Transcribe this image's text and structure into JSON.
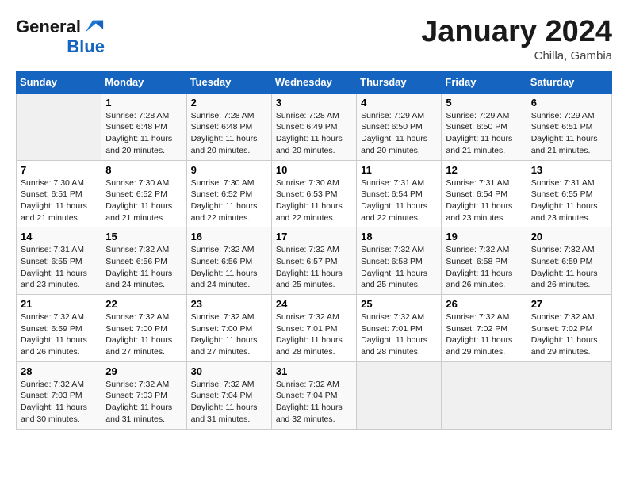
{
  "header": {
    "logo_line1": "General",
    "logo_line2": "Blue",
    "month_title": "January 2024",
    "location": "Chilla, Gambia"
  },
  "weekdays": [
    "Sunday",
    "Monday",
    "Tuesday",
    "Wednesday",
    "Thursday",
    "Friday",
    "Saturday"
  ],
  "weeks": [
    [
      {
        "day": "",
        "empty": true
      },
      {
        "day": "1",
        "sunrise": "7:28 AM",
        "sunset": "6:48 PM",
        "daylight": "11 hours and 20 minutes."
      },
      {
        "day": "2",
        "sunrise": "7:28 AM",
        "sunset": "6:48 PM",
        "daylight": "11 hours and 20 minutes."
      },
      {
        "day": "3",
        "sunrise": "7:28 AM",
        "sunset": "6:49 PM",
        "daylight": "11 hours and 20 minutes."
      },
      {
        "day": "4",
        "sunrise": "7:29 AM",
        "sunset": "6:50 PM",
        "daylight": "11 hours and 20 minutes."
      },
      {
        "day": "5",
        "sunrise": "7:29 AM",
        "sunset": "6:50 PM",
        "daylight": "11 hours and 21 minutes."
      },
      {
        "day": "6",
        "sunrise": "7:29 AM",
        "sunset": "6:51 PM",
        "daylight": "11 hours and 21 minutes."
      }
    ],
    [
      {
        "day": "7",
        "sunrise": "7:30 AM",
        "sunset": "6:51 PM",
        "daylight": "11 hours and 21 minutes."
      },
      {
        "day": "8",
        "sunrise": "7:30 AM",
        "sunset": "6:52 PM",
        "daylight": "11 hours and 21 minutes."
      },
      {
        "day": "9",
        "sunrise": "7:30 AM",
        "sunset": "6:52 PM",
        "daylight": "11 hours and 22 minutes."
      },
      {
        "day": "10",
        "sunrise": "7:30 AM",
        "sunset": "6:53 PM",
        "daylight": "11 hours and 22 minutes."
      },
      {
        "day": "11",
        "sunrise": "7:31 AM",
        "sunset": "6:54 PM",
        "daylight": "11 hours and 22 minutes."
      },
      {
        "day": "12",
        "sunrise": "7:31 AM",
        "sunset": "6:54 PM",
        "daylight": "11 hours and 23 minutes."
      },
      {
        "day": "13",
        "sunrise": "7:31 AM",
        "sunset": "6:55 PM",
        "daylight": "11 hours and 23 minutes."
      }
    ],
    [
      {
        "day": "14",
        "sunrise": "7:31 AM",
        "sunset": "6:55 PM",
        "daylight": "11 hours and 23 minutes."
      },
      {
        "day": "15",
        "sunrise": "7:32 AM",
        "sunset": "6:56 PM",
        "daylight": "11 hours and 24 minutes."
      },
      {
        "day": "16",
        "sunrise": "7:32 AM",
        "sunset": "6:56 PM",
        "daylight": "11 hours and 24 minutes."
      },
      {
        "day": "17",
        "sunrise": "7:32 AM",
        "sunset": "6:57 PM",
        "daylight": "11 hours and 25 minutes."
      },
      {
        "day": "18",
        "sunrise": "7:32 AM",
        "sunset": "6:58 PM",
        "daylight": "11 hours and 25 minutes."
      },
      {
        "day": "19",
        "sunrise": "7:32 AM",
        "sunset": "6:58 PM",
        "daylight": "11 hours and 26 minutes."
      },
      {
        "day": "20",
        "sunrise": "7:32 AM",
        "sunset": "6:59 PM",
        "daylight": "11 hours and 26 minutes."
      }
    ],
    [
      {
        "day": "21",
        "sunrise": "7:32 AM",
        "sunset": "6:59 PM",
        "daylight": "11 hours and 26 minutes."
      },
      {
        "day": "22",
        "sunrise": "7:32 AM",
        "sunset": "7:00 PM",
        "daylight": "11 hours and 27 minutes."
      },
      {
        "day": "23",
        "sunrise": "7:32 AM",
        "sunset": "7:00 PM",
        "daylight": "11 hours and 27 minutes."
      },
      {
        "day": "24",
        "sunrise": "7:32 AM",
        "sunset": "7:01 PM",
        "daylight": "11 hours and 28 minutes."
      },
      {
        "day": "25",
        "sunrise": "7:32 AM",
        "sunset": "7:01 PM",
        "daylight": "11 hours and 28 minutes."
      },
      {
        "day": "26",
        "sunrise": "7:32 AM",
        "sunset": "7:02 PM",
        "daylight": "11 hours and 29 minutes."
      },
      {
        "day": "27",
        "sunrise": "7:32 AM",
        "sunset": "7:02 PM",
        "daylight": "11 hours and 29 minutes."
      }
    ],
    [
      {
        "day": "28",
        "sunrise": "7:32 AM",
        "sunset": "7:03 PM",
        "daylight": "11 hours and 30 minutes."
      },
      {
        "day": "29",
        "sunrise": "7:32 AM",
        "sunset": "7:03 PM",
        "daylight": "11 hours and 31 minutes."
      },
      {
        "day": "30",
        "sunrise": "7:32 AM",
        "sunset": "7:04 PM",
        "daylight": "11 hours and 31 minutes."
      },
      {
        "day": "31",
        "sunrise": "7:32 AM",
        "sunset": "7:04 PM",
        "daylight": "11 hours and 32 minutes."
      },
      {
        "day": "",
        "empty": true
      },
      {
        "day": "",
        "empty": true
      },
      {
        "day": "",
        "empty": true
      }
    ]
  ]
}
